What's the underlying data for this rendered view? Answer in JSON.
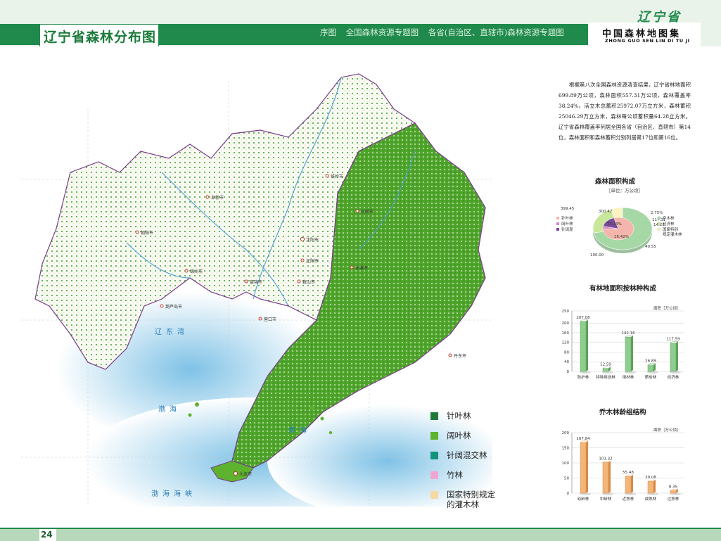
{
  "header": {
    "page_title": "辽宁省森林分布图",
    "breadcrumb": [
      "序图",
      "全国森林资源专题图",
      "各省(自治区、直辖市)森林资源专题图"
    ],
    "province_mark": "辽宁省",
    "atlas_title": "中国森林地图集",
    "atlas_pinyin": "ZHONG GUO SEN LIN DI TU JI"
  },
  "footer": {
    "page_number": "24"
  },
  "description": "根据第八次全国森林资源清查结果，辽宁省林地面积699.89万公顷，森林面积557.31万公顷，森林覆盖率38.24%。活立木总蓄积25972.07万立方米，森林蓄积25046.29万立方米，森林每公顷蓄积量64.28立方米。辽宁省森林覆盖率列居全国各省（自治区、直辖市）第14位，森林面积和森林蓄积分别列居第17位和第16位。",
  "legend": [
    {
      "label": "针叶林",
      "color": "#1f7a3a"
    },
    {
      "label": "阔叶林",
      "color": "#5db22e"
    },
    {
      "label": "针阔混交林",
      "color": "#12937a"
    },
    {
      "label": "竹林",
      "color": "#f0a6cf"
    },
    {
      "label": "国家特别规定的灌木林",
      "color": "#f7d9a3"
    }
  ],
  "colors": {
    "brand_green": "#1f8a4c",
    "broadleaf": "#5db22e",
    "conifer": "#1f7a3a",
    "water": "#9fd0ec",
    "boundary": "#7a3b8a",
    "bar_green": "#8fcc8f",
    "bar_orange": "#f3b57a"
  },
  "map": {
    "cities": [
      "朝阳市",
      "阜新市",
      "沈阳市",
      "铁岭市",
      "抚顺市",
      "本溪市",
      "辽阳市",
      "鞍山市",
      "营口市",
      "盘锦市",
      "锦州市",
      "葫芦岛市",
      "丹东市",
      "大连市"
    ],
    "sea_labels": [
      "辽东湾",
      "渤海",
      "黄海",
      "渤海海峡"
    ]
  },
  "chart_data": [
    {
      "type": "pie",
      "title": "森林面积构成",
      "subtitle": "［单位：万公顷］",
      "slices": [
        {
          "name": "乔木林",
          "value": 399.45,
          "color": "#a6d8a6"
        },
        {
          "name": "经济林",
          "value": 117.31,
          "color": "#c9e79a"
        },
        {
          "name": "国家特别规定灌木林",
          "value": 40.55,
          "color": "#fbf3c4"
        }
      ],
      "inner_slices": [
        {
          "name": "针叶林",
          "value": 77.33,
          "color": "#f4b6ac"
        },
        {
          "name": "阔叶林",
          "value": 3.75,
          "color": "#d98ac8"
        },
        {
          "name": "针阔混交林",
          "value": 16.42,
          "color": "#7a4a9a"
        }
      ],
      "legend_left": [
        "针叶林",
        "阔叶林",
        "针阔混"
      ],
      "legend_right": [
        "乔木林",
        "经济林",
        "国家特别规定灌木林"
      ],
      "value_labels": [
        "399.45",
        "300.42",
        "77.33%",
        "2.75%",
        "16.42%",
        "117.31",
        "14.23",
        "40.55",
        "100.00"
      ]
    },
    {
      "type": "bar",
      "title": "有林地面积按林种构成",
      "ylabel": "面积［万公顷］",
      "categories": [
        "防护林",
        "特种用途林",
        "用材林",
        "薪炭林",
        "经济林"
      ],
      "values": [
        207.08,
        12.59,
        142.16,
        26.89,
        117.59
      ],
      "ylim": [
        0,
        250
      ],
      "yticks": [
        0,
        40,
        80,
        120,
        160,
        200,
        250
      ]
    },
    {
      "type": "bar",
      "title": "乔木林龄组结构",
      "ylabel": "面积［万公顷］",
      "categories": [
        "幼龄林",
        "中龄林",
        "近熟林",
        "成熟林",
        "过熟林"
      ],
      "values": [
        167.84,
        101.32,
        55.48,
        39.08,
        8.35
      ],
      "ylim": [
        0,
        200
      ],
      "yticks": [
        0,
        50,
        100,
        150,
        200
      ]
    }
  ]
}
